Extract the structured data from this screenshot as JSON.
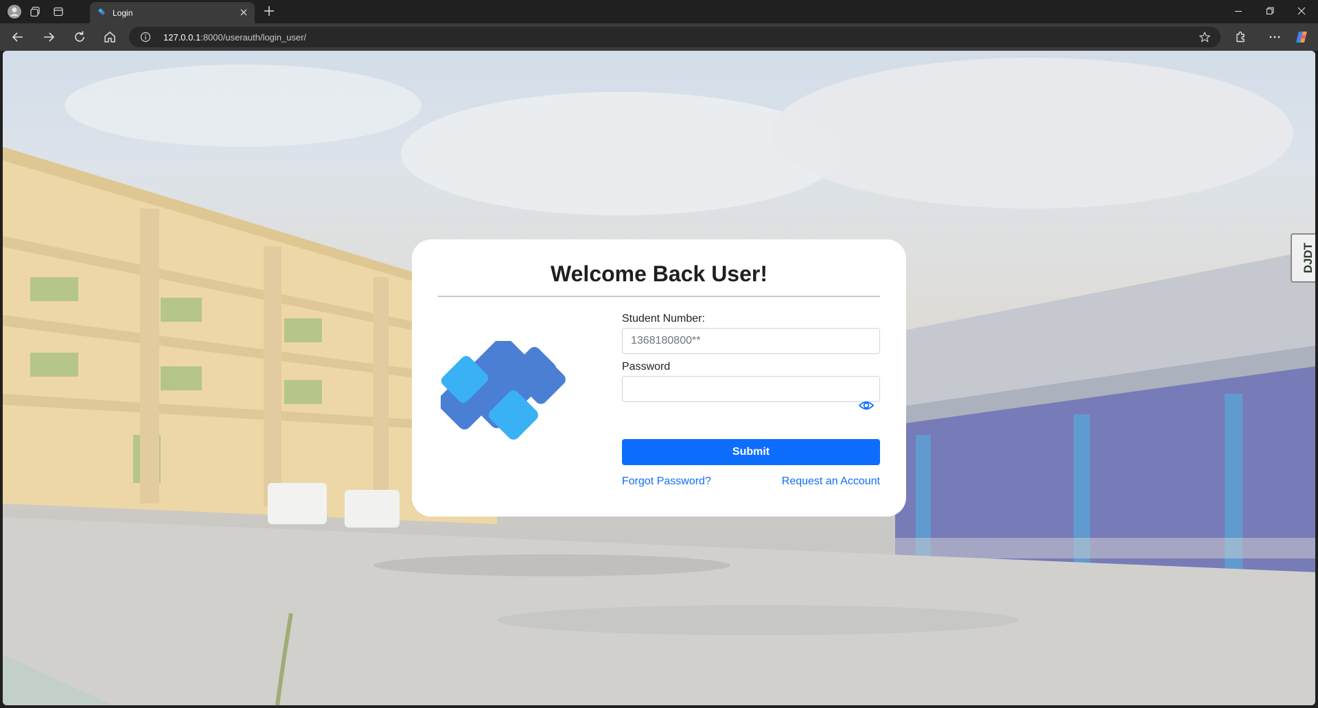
{
  "browser": {
    "tab_title": "Login",
    "url_host": "127.0.0.1",
    "url_rest": ":8000/userauth/login_user/",
    "icons": [
      "profile-icon",
      "workspaces-icon",
      "tab-actions-icon",
      "tab-favicon",
      "close-icon",
      "plus-icon",
      "minimize-icon",
      "restore-icon",
      "window-close-icon",
      "back-icon",
      "forward-icon",
      "reload-icon",
      "home-icon",
      "site-info-icon",
      "favorite-star-icon",
      "extensions-icon",
      "more-icon",
      "copilot-icon"
    ]
  },
  "login": {
    "title": "Welcome Back User!",
    "student_number_label": "Student Number:",
    "student_number_placeholder": "1368180800**",
    "password_label": "Password",
    "password_value": "",
    "submit_label": "Submit",
    "forgot_label": "Forgot Password?",
    "request_label": "Request an Account"
  },
  "debug_toolbar": {
    "label": "DJDT"
  },
  "colors": {
    "accent": "#0d6efd",
    "logo_light": "#3ab0f5",
    "logo_dark": "#4a7fd4"
  }
}
